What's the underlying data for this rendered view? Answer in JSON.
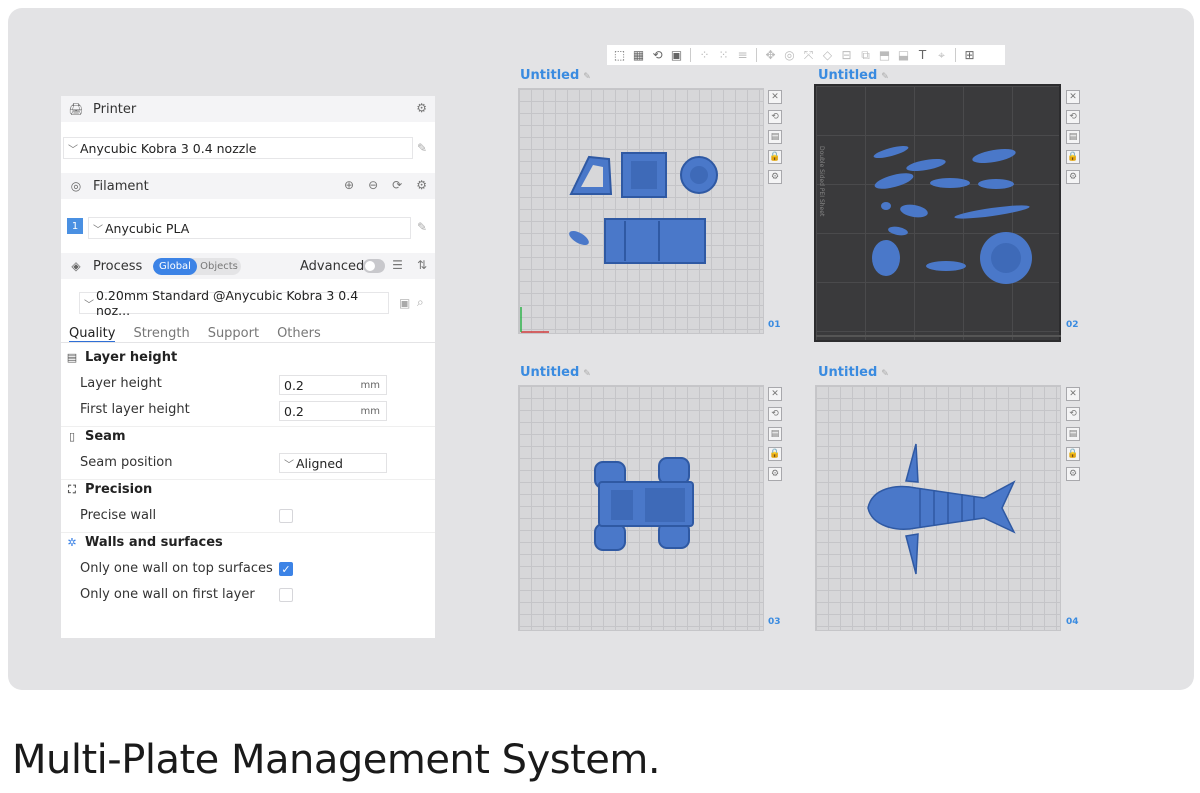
{
  "panel": {
    "printer": {
      "label": "Printer",
      "preset": "Anycubic Kobra 3 0.4 nozzle"
    },
    "filament": {
      "label": "Filament",
      "slot": "1",
      "preset": "Anycubic PLA"
    },
    "process": {
      "label": "Process",
      "scope_options": [
        "Global",
        "Objects"
      ],
      "scope_selected": "Global",
      "advanced_label": "Advanced",
      "advanced_on": false,
      "preset": "0.20mm Standard @Anycubic Kobra 3 0.4 noz..."
    },
    "tabs": [
      "Quality",
      "Strength",
      "Support",
      "Others"
    ],
    "active_tab": "Quality",
    "groups": {
      "layer_height": {
        "title": "Layer height",
        "rows": [
          {
            "label": "Layer height",
            "value": "0.2",
            "unit": "mm"
          },
          {
            "label": "First layer height",
            "value": "0.2",
            "unit": "mm"
          }
        ]
      },
      "seam": {
        "title": "Seam",
        "rows": [
          {
            "label": "Seam position",
            "value": "Aligned"
          }
        ]
      },
      "precision": {
        "title": "Precision",
        "rows": [
          {
            "label": "Precise wall",
            "checked": false
          }
        ]
      },
      "walls": {
        "title": "Walls and surfaces",
        "rows": [
          {
            "label": "Only one wall on top surfaces",
            "checked": true
          },
          {
            "label": "Only one wall on first layer",
            "checked": false
          }
        ]
      }
    }
  },
  "plates": [
    {
      "title": "Untitled",
      "number": "01"
    },
    {
      "title": "Untitled",
      "number": "02",
      "sheet_label": "Double Sided PEI Sheet"
    },
    {
      "title": "Untitled",
      "number": "03"
    },
    {
      "title": "Untitled",
      "number": "04"
    }
  ],
  "caption": "Multi-Plate Management System.",
  "colors": {
    "accent": "#3c83e6",
    "model": "#4a78c9",
    "plate_title": "#3a8be0"
  }
}
